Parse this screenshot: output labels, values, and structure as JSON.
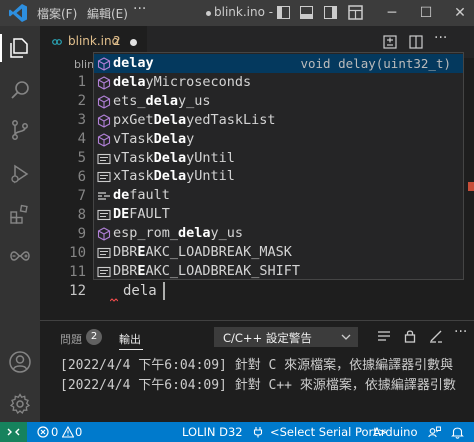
{
  "titlebar": {
    "menu_file": "檔案(F)",
    "menu_edit": "編輯(E)",
    "menu_more": "···",
    "window_title": "blink.ino -"
  },
  "tabs": [
    {
      "label": "blink.ino",
      "badge": "2",
      "dirty": true
    }
  ],
  "breadcrumb": {
    "label": "blink.ino"
  },
  "editor": {
    "line_numbers": [
      "1",
      "2",
      "3",
      "4",
      "5",
      "6",
      "7",
      "8",
      "9",
      "10",
      "11",
      "12"
    ],
    "active_line": "12",
    "current_text": "dela"
  },
  "suggest": {
    "detail": "void delay(uint32_t)",
    "items": [
      {
        "label": "delay",
        "match": "delay",
        "rest": "",
        "icon": "method-cube-icon",
        "focused": true
      },
      {
        "label": "delayMicroseconds",
        "match": "dela",
        "rest": "yMicroseconds",
        "icon": "method-cube-icon"
      },
      {
        "label": "ets_delay_us",
        "pre": "ets_",
        "match": "dela",
        "rest": "y_us",
        "icon": "method-cube-icon"
      },
      {
        "label": "pxGetDelayedTaskList",
        "pre": "pxGet",
        "match": "Dela",
        "rest": "yedTaskList",
        "icon": "method-cube-icon"
      },
      {
        "label": "vTaskDelay",
        "pre": "vTask",
        "match": "Dela",
        "rest": "y",
        "icon": "method-cube-icon"
      },
      {
        "label": "vTaskDelayUntil",
        "pre": "vTask",
        "match": "Dela",
        "rest": "yUntil",
        "icon": "text-keyword-icon"
      },
      {
        "label": "xTaskDelayUntil",
        "pre": "xTask",
        "match": "Dela",
        "rest": "yUntil",
        "icon": "text-keyword-icon"
      },
      {
        "label": "default",
        "match": "de",
        "rest": "fault",
        "icon": "keyword-icon"
      },
      {
        "label": "DEFAULT",
        "match": "DE",
        "rest": "FAULT",
        "icon": "text-keyword-icon"
      },
      {
        "label": "esp_rom_delay_us",
        "pre": "esp_rom_",
        "match": "dela",
        "rest": "y_us",
        "icon": "method-cube-icon"
      },
      {
        "label": "DBREAKC_LOADBREAK_MASK",
        "pre": "DBR",
        "match": "E",
        "rest": "AKC_LOADBREAK_MASK",
        "icon": "text-keyword-icon"
      },
      {
        "label": "DBREAKC_LOADBREAK_SHIFT",
        "pre": "DBR",
        "match": "E",
        "rest": "AKC_LOADBREAK_SHIFT",
        "icon": "text-keyword-icon"
      }
    ]
  },
  "panel": {
    "tab_problems": "問題",
    "problems_count": "2",
    "tab_output": "輸出",
    "channel": "C/C++ 設定警告",
    "more": "···",
    "output_lines": [
      "[2022/4/4 下午6:04:09] 針對 C 來源檔案，依據編譯器引數與",
      "[2022/4/4 下午6:04:09] 針對 C++ 來源檔案，依據編譯器引數"
    ]
  },
  "statusbar": {
    "errors": "0",
    "warnings": "0",
    "board": "LOLIN D32",
    "port": "<Select Serial Port>",
    "language": "Arduino"
  },
  "colors": {
    "accent": "#007acc",
    "remote": "#16825d",
    "modified": "#e2c08d",
    "focus_row": "#04395e"
  }
}
